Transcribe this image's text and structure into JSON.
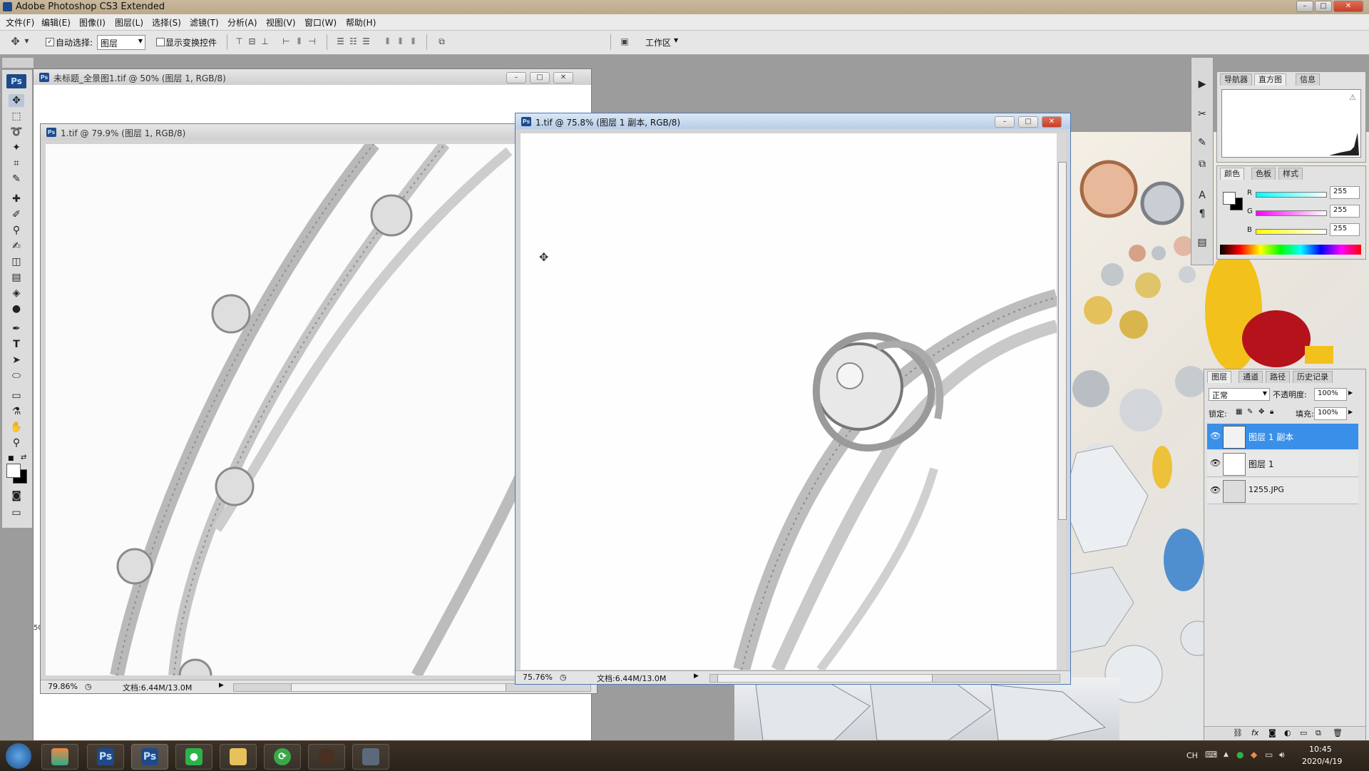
{
  "app": {
    "title": "Adobe Photoshop CS3 Extended"
  },
  "menu": [
    {
      "label": "文件(F)"
    },
    {
      "label": "编辑(E)"
    },
    {
      "label": "图像(I)"
    },
    {
      "label": "图层(L)"
    },
    {
      "label": "选择(S)"
    },
    {
      "label": "滤镜(T)"
    },
    {
      "label": "分析(A)"
    },
    {
      "label": "视图(V)"
    },
    {
      "label": "窗口(W)"
    },
    {
      "label": "帮助(H)"
    }
  ],
  "options": {
    "auto_select_label": "自动选择:",
    "auto_select_value": "图层",
    "show_transform_label": "显示变换控件",
    "workspace_label": "工作区"
  },
  "docs": {
    "back": {
      "title": "未标题_全景图1.tif @ 50% (图层 1, RGB/8)",
      "ruler_mark": "50"
    },
    "left": {
      "title": "1.tif @ 79.9% (图层 1, RGB/8)",
      "zoom": "79.86%",
      "doc": "文档:6.44M/13.0M"
    },
    "front": {
      "title": "1.tif @ 75.8% (图层 1 副本, RGB/8)",
      "zoom": "75.76%",
      "doc": "文档:6.44M/13.0M"
    }
  },
  "navigator": {
    "tabs": [
      "导航器",
      "直方图",
      "信息"
    ]
  },
  "color": {
    "tabs": [
      "颜色",
      "色板",
      "样式"
    ],
    "channels": [
      {
        "label": "R",
        "value": "255"
      },
      {
        "label": "G",
        "value": "255"
      },
      {
        "label": "B",
        "value": "255"
      }
    ]
  },
  "layers": {
    "tabs": [
      "图层",
      "通道",
      "路径",
      "历史记录"
    ],
    "blend_mode": "正常",
    "opacity_label": "不透明度:",
    "opacity": "100%",
    "lock_label": "锁定:",
    "fill_label": "填充:",
    "fill": "100%",
    "items": [
      {
        "name": "图层 1 副本"
      },
      {
        "name": "图层 1"
      },
      {
        "name": "1255.JPG"
      }
    ]
  },
  "taskbar": {
    "lang": "CH",
    "time": "10:45",
    "date": "2020/4/19"
  },
  "colors": {
    "selection": "#3a8fe8",
    "ps_blue": "#1f4a8a"
  }
}
